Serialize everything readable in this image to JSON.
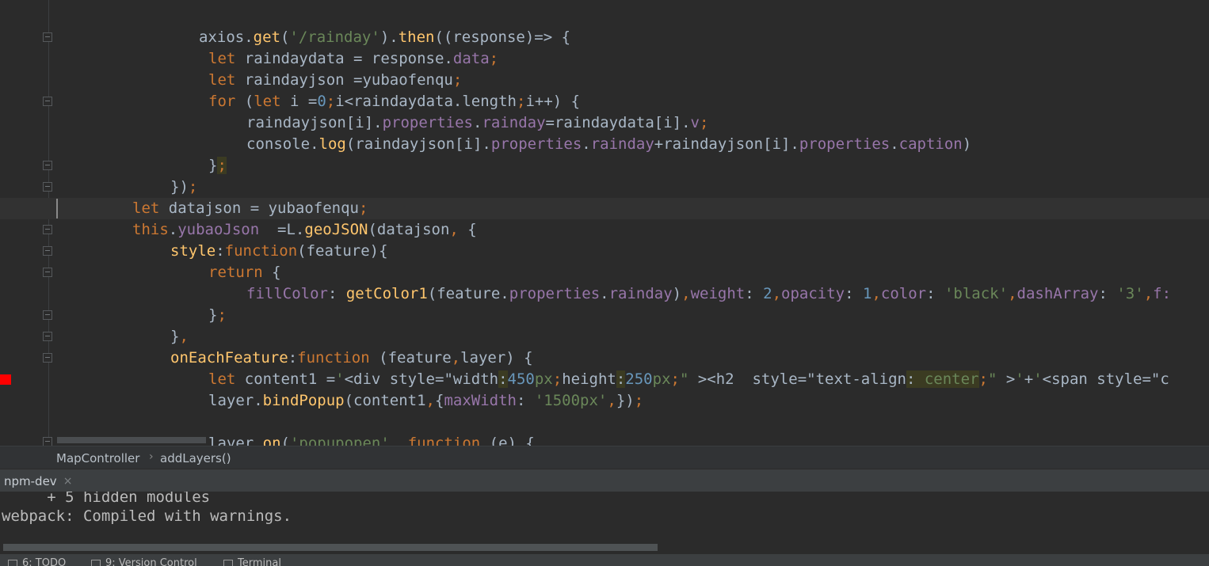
{
  "editor": {
    "lines": [
      {
        "tokens": [
          {
            "c": "t",
            "v": "axios."
          },
          {
            "c": "f",
            "v": "get"
          },
          {
            "c": "t",
            "v": "("
          },
          {
            "c": "s",
            "v": "'/rainday'"
          },
          {
            "c": "t",
            "v": ")."
          },
          {
            "c": "f",
            "v": "then"
          },
          {
            "c": "t",
            "v": "((response)=> {"
          }
        ]
      },
      {
        "tokens": [
          {
            "c": "k",
            "v": "let "
          },
          {
            "c": "t",
            "v": "raindaydata = response."
          },
          {
            "c": "p",
            "v": "data"
          },
          {
            "c": "k",
            "v": ";"
          }
        ]
      },
      {
        "tokens": [
          {
            "c": "k",
            "v": "let "
          },
          {
            "c": "t",
            "v": "raindayjson =yubaofenqu"
          },
          {
            "c": "k",
            "v": ";"
          }
        ]
      },
      {
        "tokens": [
          {
            "c": "k",
            "v": "for "
          },
          {
            "c": "t",
            "v": "("
          },
          {
            "c": "k",
            "v": "let "
          },
          {
            "c": "t",
            "v": "i ="
          },
          {
            "c": "n",
            "v": "0"
          },
          {
            "c": "k",
            "v": ";"
          },
          {
            "c": "t",
            "v": "i<raindaydata.length"
          },
          {
            "c": "k",
            "v": ";"
          },
          {
            "c": "t",
            "v": "i++) {"
          }
        ]
      },
      {
        "tokens": [
          {
            "c": "t",
            "v": "raindayjson[i]."
          },
          {
            "c": "p",
            "v": "properties"
          },
          {
            "c": "t",
            "v": "."
          },
          {
            "c": "p",
            "v": "rainday"
          },
          {
            "c": "t",
            "v": "=raindaydata[i]."
          },
          {
            "c": "p",
            "v": "v"
          },
          {
            "c": "k",
            "v": ";"
          }
        ]
      },
      {
        "tokens": [
          {
            "c": "t",
            "v": "console."
          },
          {
            "c": "f",
            "v": "log"
          },
          {
            "c": "t",
            "v": "(raindayjson[i]."
          },
          {
            "c": "p",
            "v": "properties"
          },
          {
            "c": "t",
            "v": "."
          },
          {
            "c": "p",
            "v": "rainday"
          },
          {
            "c": "t",
            "v": "+raindayjson[i]."
          },
          {
            "c": "p",
            "v": "properties"
          },
          {
            "c": "t",
            "v": "."
          },
          {
            "c": "p",
            "v": "caption"
          },
          {
            "c": "t",
            "v": ")"
          }
        ]
      },
      {
        "tokens": [
          {
            "c": "t",
            "v": "}"
          },
          {
            "c": "k hl",
            "v": ";"
          }
        ]
      },
      {
        "tokens": [
          {
            "c": "t",
            "v": "})"
          },
          {
            "c": "k",
            "v": ";"
          }
        ]
      },
      {
        "tokens": [
          {
            "c": "k",
            "v": "let "
          },
          {
            "c": "t",
            "v": "datajson = yubaofenqu"
          },
          {
            "c": "k",
            "v": ";"
          }
        ]
      },
      {
        "tokens": [
          {
            "c": "k",
            "v": "this"
          },
          {
            "c": "t",
            "v": "."
          },
          {
            "c": "p",
            "v": "yubaoJson"
          },
          {
            "c": "t",
            "v": "  =L."
          },
          {
            "c": "f",
            "v": "geoJSON"
          },
          {
            "c": "t",
            "v": "(datajson"
          },
          {
            "c": "k",
            "v": ", "
          },
          {
            "c": "t",
            "v": "{"
          }
        ]
      },
      {
        "tokens": [
          {
            "c": "f",
            "v": "style"
          },
          {
            "c": "t",
            "v": ":"
          },
          {
            "c": "k",
            "v": "function"
          },
          {
            "c": "t",
            "v": "(feature){"
          }
        ]
      },
      {
        "tokens": [
          {
            "c": "k",
            "v": "return "
          },
          {
            "c": "t",
            "v": "{"
          }
        ]
      },
      {
        "tokens": [
          {
            "c": "p",
            "v": "fillColor"
          },
          {
            "c": "t",
            "v": ": "
          },
          {
            "c": "f",
            "v": "getColor1"
          },
          {
            "c": "t",
            "v": "(feature."
          },
          {
            "c": "p",
            "v": "properties"
          },
          {
            "c": "t",
            "v": "."
          },
          {
            "c": "p",
            "v": "rainday"
          },
          {
            "c": "t",
            "v": ")"
          },
          {
            "c": "k",
            "v": ","
          },
          {
            "c": "p",
            "v": "weight"
          },
          {
            "c": "t",
            "v": ": "
          },
          {
            "c": "n",
            "v": "2"
          },
          {
            "c": "k",
            "v": ","
          },
          {
            "c": "p",
            "v": "opacity"
          },
          {
            "c": "t",
            "v": ": "
          },
          {
            "c": "n",
            "v": "1"
          },
          {
            "c": "k",
            "v": ","
          },
          {
            "c": "p",
            "v": "color"
          },
          {
            "c": "t",
            "v": ": "
          },
          {
            "c": "s",
            "v": "'black'"
          },
          {
            "c": "k",
            "v": ","
          },
          {
            "c": "p",
            "v": "dashArray"
          },
          {
            "c": "t",
            "v": ": "
          },
          {
            "c": "s",
            "v": "'3'"
          },
          {
            "c": "k",
            "v": ","
          },
          {
            "c": "p",
            "v": "f:"
          }
        ]
      },
      {
        "tokens": [
          {
            "c": "t",
            "v": "}"
          },
          {
            "c": "k",
            "v": ";"
          }
        ]
      },
      {
        "tokens": [
          {
            "c": "t",
            "v": "}"
          },
          {
            "c": "k",
            "v": ","
          }
        ]
      },
      {
        "tokens": [
          {
            "c": "f",
            "v": "onEachFeature"
          },
          {
            "c": "t",
            "v": ":"
          },
          {
            "c": "k",
            "v": "function "
          },
          {
            "c": "t",
            "v": "(feature"
          },
          {
            "c": "k",
            "v": ","
          },
          {
            "c": "t",
            "v": "layer) {"
          }
        ]
      },
      {
        "tokens": [
          {
            "c": "k",
            "v": "let "
          },
          {
            "c": "t",
            "v": "content1 ="
          },
          {
            "c": "s",
            "v": "'"
          },
          {
            "c": "t",
            "v": "<div style=\"width"
          },
          {
            "c": "t hl",
            "v": ":"
          },
          {
            "c": "n",
            "v": "450"
          },
          {
            "c": "s",
            "v": "px"
          },
          {
            "c": "k",
            "v": ";"
          },
          {
            "c": "t",
            "v": "height"
          },
          {
            "c": "t hl",
            "v": ":"
          },
          {
            "c": "n",
            "v": "250"
          },
          {
            "c": "s",
            "v": "px"
          },
          {
            "c": "k",
            "v": ";"
          },
          {
            "c": "s",
            "v": "\" "
          },
          {
            "c": "t",
            "v": "><h2  style=\"text-align"
          },
          {
            "c": "t hl",
            "v": ": "
          },
          {
            "c": "s hl",
            "v": "center"
          },
          {
            "c": "k",
            "v": ";"
          },
          {
            "c": "s",
            "v": "\" "
          },
          {
            "c": "t",
            "v": ">"
          },
          {
            "c": "s",
            "v": "'"
          },
          {
            "c": "t",
            "v": "+"
          },
          {
            "c": "s",
            "v": "'"
          },
          {
            "c": "t",
            "v": "<span style=\"c"
          }
        ]
      },
      {
        "tokens": [
          {
            "c": "t",
            "v": "layer."
          },
          {
            "c": "f",
            "v": "bindPopup"
          },
          {
            "c": "t",
            "v": "(content1"
          },
          {
            "c": "k",
            "v": ","
          },
          {
            "c": "t",
            "v": "{"
          },
          {
            "c": "p",
            "v": "maxWidth"
          },
          {
            "c": "t",
            "v": ": "
          },
          {
            "c": "s",
            "v": "'1500px'"
          },
          {
            "c": "k",
            "v": ","
          },
          {
            "c": "t",
            "v": "})"
          },
          {
            "c": "k",
            "v": ";"
          }
        ]
      },
      {
        "tokens": []
      },
      {
        "tokens": [
          {
            "c": "t",
            "v": "layer."
          },
          {
            "c": "f",
            "v": "on"
          },
          {
            "c": "t",
            "v": "("
          },
          {
            "c": "s",
            "v": "'popupopen'"
          },
          {
            "c": "k",
            "v": ", function "
          },
          {
            "c": "t",
            "v": "(e) {"
          }
        ]
      }
    ]
  },
  "breadcrumb": {
    "items": [
      "MapController",
      "addLayers()"
    ]
  },
  "run_tab": {
    "label": "npm-dev",
    "close": "×"
  },
  "console": {
    "lines": [
      "     + 5 hidden modules",
      "webpack: Compiled with warnings."
    ]
  },
  "statusbar": {
    "items": [
      "6: TODO",
      "9: Version Control",
      "Terminal"
    ]
  }
}
